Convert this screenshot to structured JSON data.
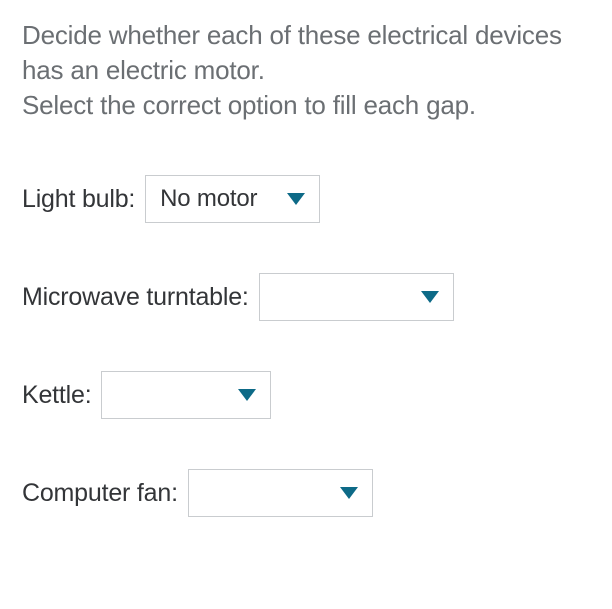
{
  "prompt": {
    "line1": "Decide whether each of these electrical devices has an electric motor.",
    "line2": "Select the correct option to fill each gap."
  },
  "items": [
    {
      "label": "Light bulb:",
      "selected": "No motor",
      "has_value": true
    },
    {
      "label": "Microwave turntable:",
      "selected": "",
      "has_value": false
    },
    {
      "label": "Kettle:",
      "selected": "",
      "has_value": false
    },
    {
      "label": "Computer fan:",
      "selected": "",
      "has_value": false
    }
  ],
  "colors": {
    "caret": "#0d6a87",
    "prompt_text": "#6b6f73",
    "label_text": "#333538",
    "border": "#c9cccf"
  }
}
